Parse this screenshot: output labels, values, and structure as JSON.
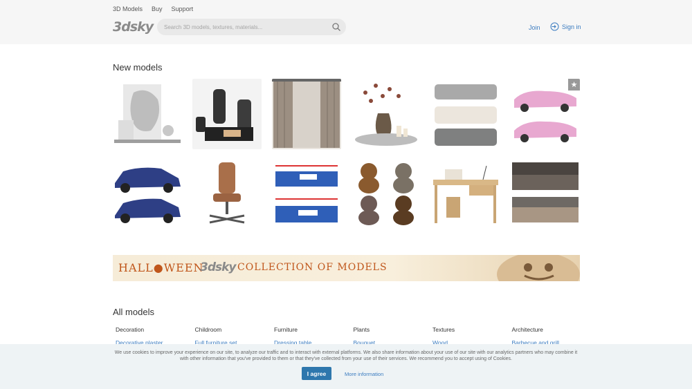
{
  "nav": {
    "items": [
      "3D Models",
      "Buy",
      "Support"
    ]
  },
  "logo": "3dsky",
  "search": {
    "placeholder": "Search 3D models, textures, materials..."
  },
  "auth": {
    "join": "Join",
    "signin": "Sign in"
  },
  "new_models": {
    "title": "New models",
    "tiles": [
      {
        "name": "sculpture-decor-set"
      },
      {
        "name": "bathroom-accessories-set"
      },
      {
        "name": "curtains"
      },
      {
        "name": "vase-with-dry-flowers"
      },
      {
        "name": "modular-sofa-set"
      },
      {
        "name": "pink-vintage-car"
      },
      {
        "name": "blue-suv"
      },
      {
        "name": "leather-office-chair"
      },
      {
        "name": "boxing-ring"
      },
      {
        "name": "plush-toys"
      },
      {
        "name": "writing-desk-set"
      },
      {
        "name": "beds"
      }
    ]
  },
  "banner": {
    "halloween": "HALL●WEEN",
    "logo": "3dsky",
    "text": "COLLECTION OF MODELS"
  },
  "all_models": {
    "title": "All models",
    "categories": [
      {
        "name": "Decoration",
        "first": "Decorative plaster"
      },
      {
        "name": "Childroom",
        "first": "Full furniture set"
      },
      {
        "name": "Furniture",
        "first": "Dressing table"
      },
      {
        "name": "Plants",
        "first": "Bouquet"
      },
      {
        "name": "Textures",
        "first": "Wood"
      },
      {
        "name": "Architecture",
        "first": "Barbecue and grill"
      }
    ]
  },
  "cookie": {
    "text": "We use cookies to improve your experience on our site, to analyze our traffic and to interact with external platforms. We also share information about your use of our site with our analytics partners who may combine it with other information that you've provided to them or that they've collected from your use of their services. We recommend you to accept using of Cookies.",
    "agree": "I agree",
    "more": "More information"
  },
  "colors": {
    "link": "#3b7cc0",
    "header_bg": "#f6f6f6",
    "accent_orange": "#c0561b",
    "button": "#2e77ad"
  }
}
